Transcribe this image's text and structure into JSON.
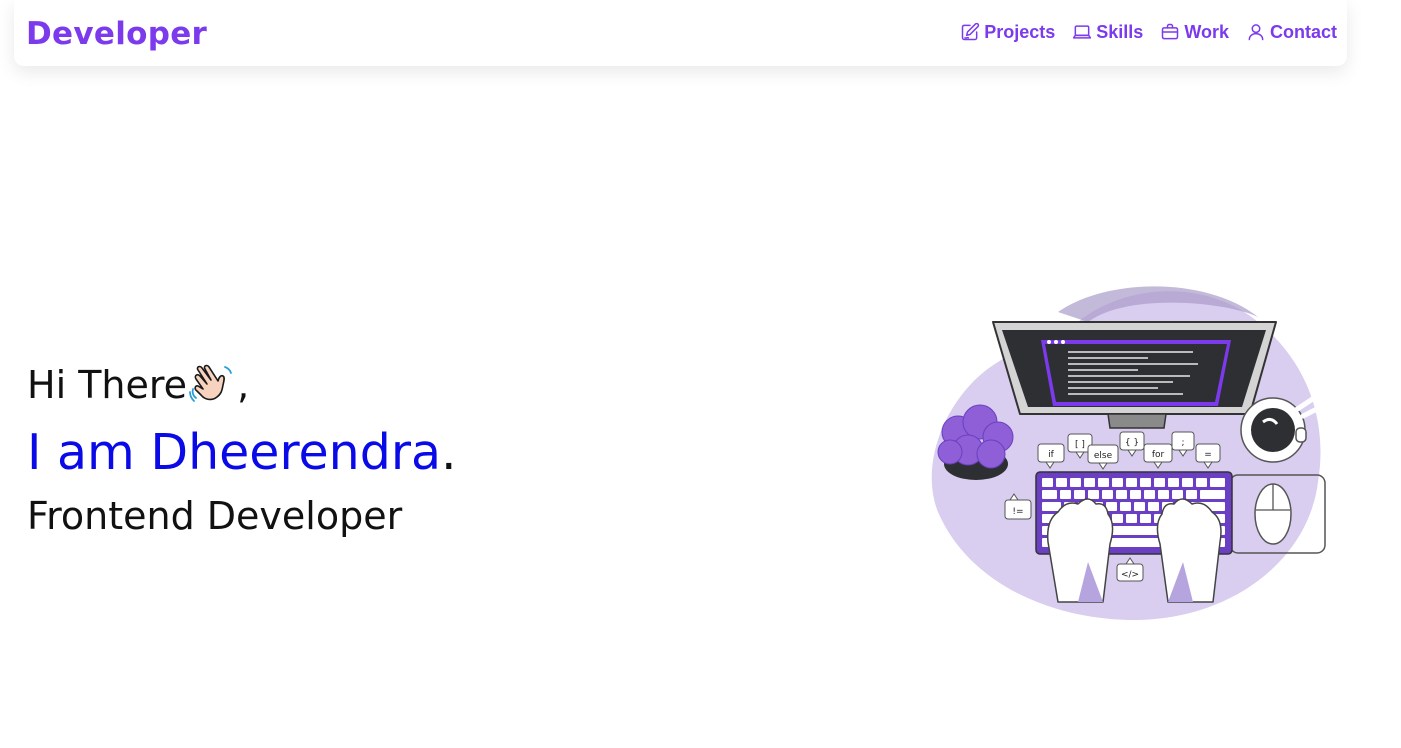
{
  "brand": "Developer",
  "nav": {
    "items": [
      {
        "label": "Projects",
        "icon": "edit-icon"
      },
      {
        "label": "Skills",
        "icon": "laptop-icon"
      },
      {
        "label": "Work",
        "icon": "briefcase-icon"
      },
      {
        "label": "Contact",
        "icon": "user-icon"
      }
    ]
  },
  "hero": {
    "greeting": "Hi There",
    "greeting_suffix": ",",
    "intro_prefix": "I am ",
    "name": "Dheerendra",
    "name_suffix": ".",
    "role": "Frontend Developer"
  },
  "illustration": {
    "code_bubbles": [
      "if",
      "[ ]",
      "else",
      "{ }",
      "for",
      ";",
      "=",
      "!=",
      "</>"
    ]
  },
  "colors": {
    "accent": "#7c3aed",
    "name": "#0a0ae8",
    "lavender": "#d9cdf0"
  }
}
